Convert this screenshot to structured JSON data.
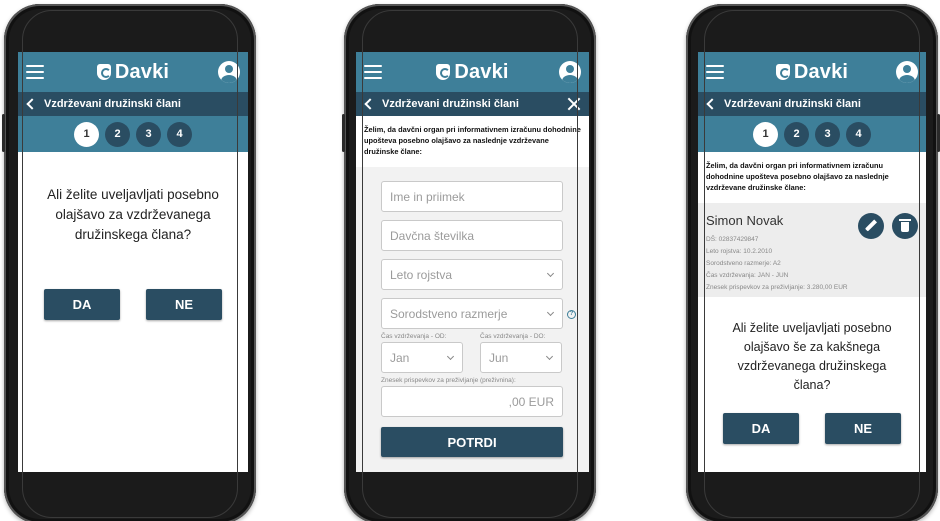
{
  "app": {
    "logo_text": "Davki",
    "section_title": "Vzdrževani družinski člani",
    "steps": [
      "1",
      "2",
      "3",
      "4"
    ]
  },
  "screen1": {
    "question": "Ali želite uveljavljati posebno olajšavo za vzdrževanega družinskega člana?",
    "yes_label": "DA",
    "no_label": "NE"
  },
  "screen2": {
    "intro": "Želim, da davčni organ pri informativnem izračunu dohodnine upošteva posebno olajšavo za naslednje vzdrževane družinske člane:",
    "name_placeholder": "Ime in priimek",
    "tax_number_placeholder": "Davčna številka",
    "birth_year_placeholder": "Leto rojstva",
    "relation_placeholder": "Sorodstveno razmerje",
    "period_from_label": "Čas vzdrževanja - OD:",
    "period_to_label": "Čas vzdrževanja - DO:",
    "period_from_value": "Jan",
    "period_to_value": "Jun",
    "amount_label": "Znesek prispevkov za preživljanje (preživnina):",
    "amount_placeholder": ",00 EUR",
    "confirm_label": "POTRDI"
  },
  "screen3": {
    "intro": "Želim, da davčni organ pri informativnem izračunu dohodnine upošteva posebno olajšavo za naslednje vzdrževane družinske člane:",
    "member": {
      "name": "Simon Novak",
      "tax_number": "DŠ: 02837429847",
      "birth": "Leto rojstva: 10.2.2010",
      "relation": "Sorodstveno razmerje: A2",
      "period": "Čas vzdrževanja: JAN - JUN",
      "amount": "Znesek prispevkov za preživljanje: 3.280,00 EUR"
    },
    "question": "Ali želite uveljavljati posebno olajšavo še za kakšnega vzdrževanega družinskega člana?",
    "yes_label": "DA",
    "no_label": "NE"
  },
  "colors": {
    "primary": "#3e7f99",
    "dark": "#2a4d62"
  }
}
